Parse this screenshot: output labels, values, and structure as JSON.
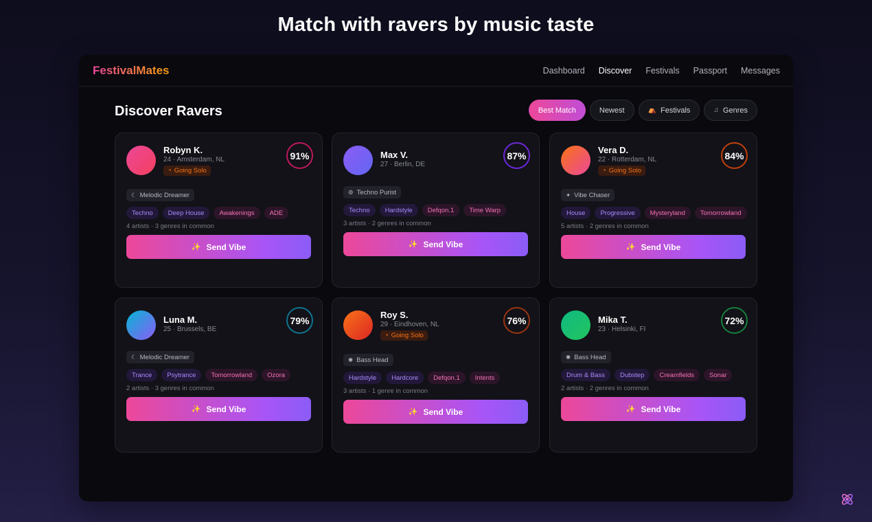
{
  "page": {
    "heading": "Match with ravers by music taste"
  },
  "app": {
    "logo": "FestivalMates",
    "nav": [
      {
        "label": "Dashboard",
        "active": false
      },
      {
        "label": "Discover",
        "active": true
      },
      {
        "label": "Festivals",
        "active": false
      },
      {
        "label": "Passport",
        "active": false
      },
      {
        "label": "Messages",
        "active": false
      }
    ]
  },
  "discover": {
    "title": "Discover Ravers",
    "filters": [
      {
        "label": "Best Match",
        "icon": "",
        "active": true
      },
      {
        "label": "Newest",
        "icon": "",
        "active": false
      },
      {
        "label": "Festivals",
        "icon": "tent-icon",
        "active": false
      },
      {
        "label": "Genres",
        "icon": "music-note-icon",
        "active": false
      }
    ],
    "send_label": "Send Vibe",
    "cards": [
      {
        "name": "Robyn K.",
        "meta": "24 · Amsterdam, NL",
        "solo": "Going Solo",
        "match": "91%",
        "match_color": "#be185d",
        "avatar": [
          "#ec4899",
          "#f43f5e"
        ],
        "persona": "Melodic Dreamer",
        "persona_icon": "moon-icon",
        "tags": [
          {
            "label": "Techno",
            "kind": "purple"
          },
          {
            "label": "Deep House",
            "kind": "purple"
          },
          {
            "label": "Awakenings",
            "kind": "pink"
          },
          {
            "label": "ADE",
            "kind": "pink"
          }
        ],
        "common": "4 artists · 3 genres in common"
      },
      {
        "name": "Max V.",
        "meta": "27 · Berlin, DE",
        "solo": "",
        "match": "87%",
        "match_color": "#6d28d9",
        "avatar": [
          "#8b5cf6",
          "#6366f1"
        ],
        "persona": "Techno Purist",
        "persona_icon": "gear-icon",
        "tags": [
          {
            "label": "Techno",
            "kind": "purple"
          },
          {
            "label": "Hardstyle",
            "kind": "purple"
          },
          {
            "label": "Defqon.1",
            "kind": "pink"
          },
          {
            "label": "Time Warp",
            "kind": "pink"
          }
        ],
        "common": "3 artists · 2 genres in common"
      },
      {
        "name": "Vera D.",
        "meta": "22 · Rotterdam, NL",
        "solo": "Going Solo",
        "match": "84%",
        "match_color": "#c2410c",
        "avatar": [
          "#f97316",
          "#ec4899"
        ],
        "persona": "Vibe Chaser",
        "persona_icon": "sparkle-icon",
        "tags": [
          {
            "label": "House",
            "kind": "purple"
          },
          {
            "label": "Progressive",
            "kind": "purple"
          },
          {
            "label": "Mysteryland",
            "kind": "pink"
          },
          {
            "label": "Tomorrowland",
            "kind": "pink"
          }
        ],
        "common": "5 artists · 2 genres in common"
      },
      {
        "name": "Luna M.",
        "meta": "25 · Brussels, BE",
        "solo": "",
        "match": "79%",
        "match_color": "#0e7490",
        "avatar": [
          "#06b6d4",
          "#8b5cf6"
        ],
        "persona": "Melodic Dreamer",
        "persona_icon": "moon-icon",
        "tags": [
          {
            "label": "Trance",
            "kind": "purple"
          },
          {
            "label": "Psytrance",
            "kind": "purple"
          },
          {
            "label": "Tomorrowland",
            "kind": "pink"
          },
          {
            "label": "Ozora",
            "kind": "pink"
          }
        ],
        "common": "2 artists · 3 genres in common"
      },
      {
        "name": "Roy S.",
        "meta": "29 · Eindhoven, NL",
        "solo": "Going Solo",
        "match": "76%",
        "match_color": "#9a3412",
        "avatar": [
          "#f97316",
          "#dc2626"
        ],
        "persona": "Bass Head",
        "persona_icon": "burst-icon",
        "tags": [
          {
            "label": "Hardstyle",
            "kind": "purple"
          },
          {
            "label": "Hardcore",
            "kind": "purple"
          },
          {
            "label": "Defqon.1",
            "kind": "pink"
          },
          {
            "label": "Intents",
            "kind": "pink"
          }
        ],
        "common": "3 artists · 1 genre in common"
      },
      {
        "name": "Mika T.",
        "meta": "23 · Helsinki, FI",
        "solo": "",
        "match": "72%",
        "match_color": "#15803d",
        "avatar": [
          "#10b981",
          "#22c55e"
        ],
        "persona": "Bass Head",
        "persona_icon": "burst-icon",
        "tags": [
          {
            "label": "Drum & Bass",
            "kind": "purple"
          },
          {
            "label": "Dubstep",
            "kind": "purple"
          },
          {
            "label": "Creamfields",
            "kind": "pink"
          },
          {
            "label": "Sonar",
            "kind": "pink"
          }
        ],
        "common": "2 artists · 2 genres in common"
      }
    ]
  }
}
